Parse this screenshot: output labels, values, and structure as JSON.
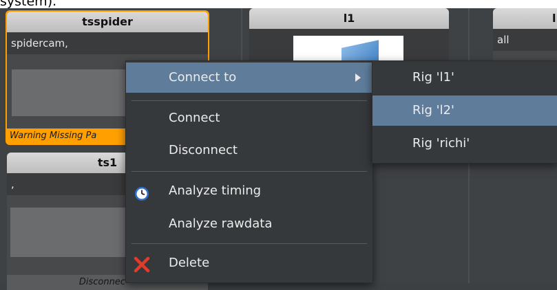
{
  "caption_fragment": "system).",
  "colors": {
    "warning": "#ff9f00",
    "highlight": "#5f7d9b",
    "panel": "#36393c"
  },
  "cards": {
    "tsspider": {
      "title": "tsspider",
      "subtitle": "spidercam,",
      "footer": "Warning Missing Pa"
    },
    "ts1": {
      "title": "ts1",
      "subtitle": ",",
      "footer": "Disconnec"
    },
    "l1": {
      "title": "l1"
    },
    "right": {
      "title": "l",
      "subtitle": "all"
    }
  },
  "menu": {
    "connect_to": "Connect to",
    "connect": "Connect",
    "disconnect": "Disconnect",
    "analyze_timing": "Analyze timing",
    "analyze_rawdata": "Analyze rawdata",
    "delete": "Delete",
    "icons": {
      "timing": "clock-icon",
      "delete": "red-x-icon",
      "submenu": "chevron-right-icon"
    }
  },
  "submenu": {
    "items": [
      "Rig 'l1'",
      "Rig 'l2'",
      "Rig 'richi'"
    ]
  }
}
